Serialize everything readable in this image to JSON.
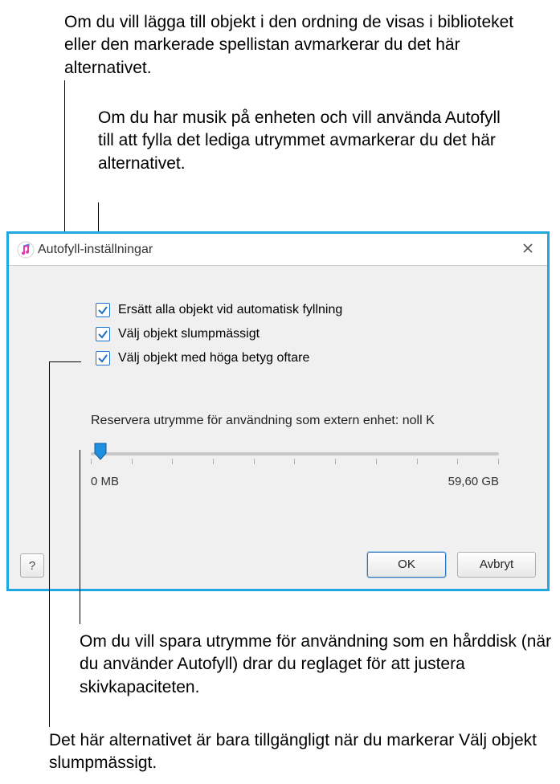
{
  "callouts": {
    "top1": "Om du vill lägga till objekt i den ordning de visas i biblioteket eller den markerade spellistan avmarkerar du det här alternativet.",
    "top2": "Om du har musik på enheten och vill använda Autofyll till att fylla det lediga utrymmet avmarkerar du det här alternativet.",
    "bottom1": "Om du vill spara utrymme för användning som en hårddisk (när du använder Autofyll) drar du reglaget för att justera skivkapaciteten.",
    "bottom2": "Det här alternativet är bara tillgängligt när du markerar Välj objekt slumpmässigt."
  },
  "dialog": {
    "title": "Autofyll-inställningar",
    "checkboxes": [
      {
        "label": "Ersätt alla objekt vid automatisk fyllning"
      },
      {
        "label": "Välj objekt slumpmässigt"
      },
      {
        "label": "Välj objekt med höga betyg oftare"
      }
    ],
    "reserve_label": "Reservera utrymme för användning som extern enhet: noll K",
    "slider": {
      "min_label": "0 MB",
      "max_label": "59,60 GB"
    },
    "buttons": {
      "ok": "OK",
      "cancel": "Avbryt",
      "help": "?"
    }
  }
}
